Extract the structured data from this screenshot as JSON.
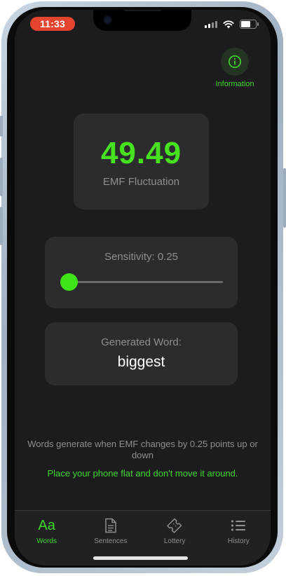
{
  "status_bar": {
    "time": "11:33"
  },
  "header": {
    "info_label": "Information"
  },
  "emf": {
    "value": "49.49",
    "label": "EMF Fluctuation"
  },
  "sensitivity": {
    "label": "Sensitivity: 0.25",
    "value": 0.25
  },
  "generated": {
    "label": "Generated Word:",
    "word": "biggest"
  },
  "footer": {
    "note": "Words generate when EMF changes by 0.25 points up or down",
    "warning": "Place your phone flat and don't move it around."
  },
  "tabs": [
    {
      "label": "Words",
      "icon": "text-aa-icon",
      "active": true
    },
    {
      "label": "Sentences",
      "icon": "document-icon",
      "active": false
    },
    {
      "label": "Lottery",
      "icon": "ticket-icon",
      "active": false
    },
    {
      "label": "History",
      "icon": "list-icon",
      "active": false
    }
  ],
  "colors": {
    "accent": "#3fd82a",
    "background": "#1c1c1e",
    "card": "#2c2c2e",
    "time_pill": "#e5452f"
  }
}
